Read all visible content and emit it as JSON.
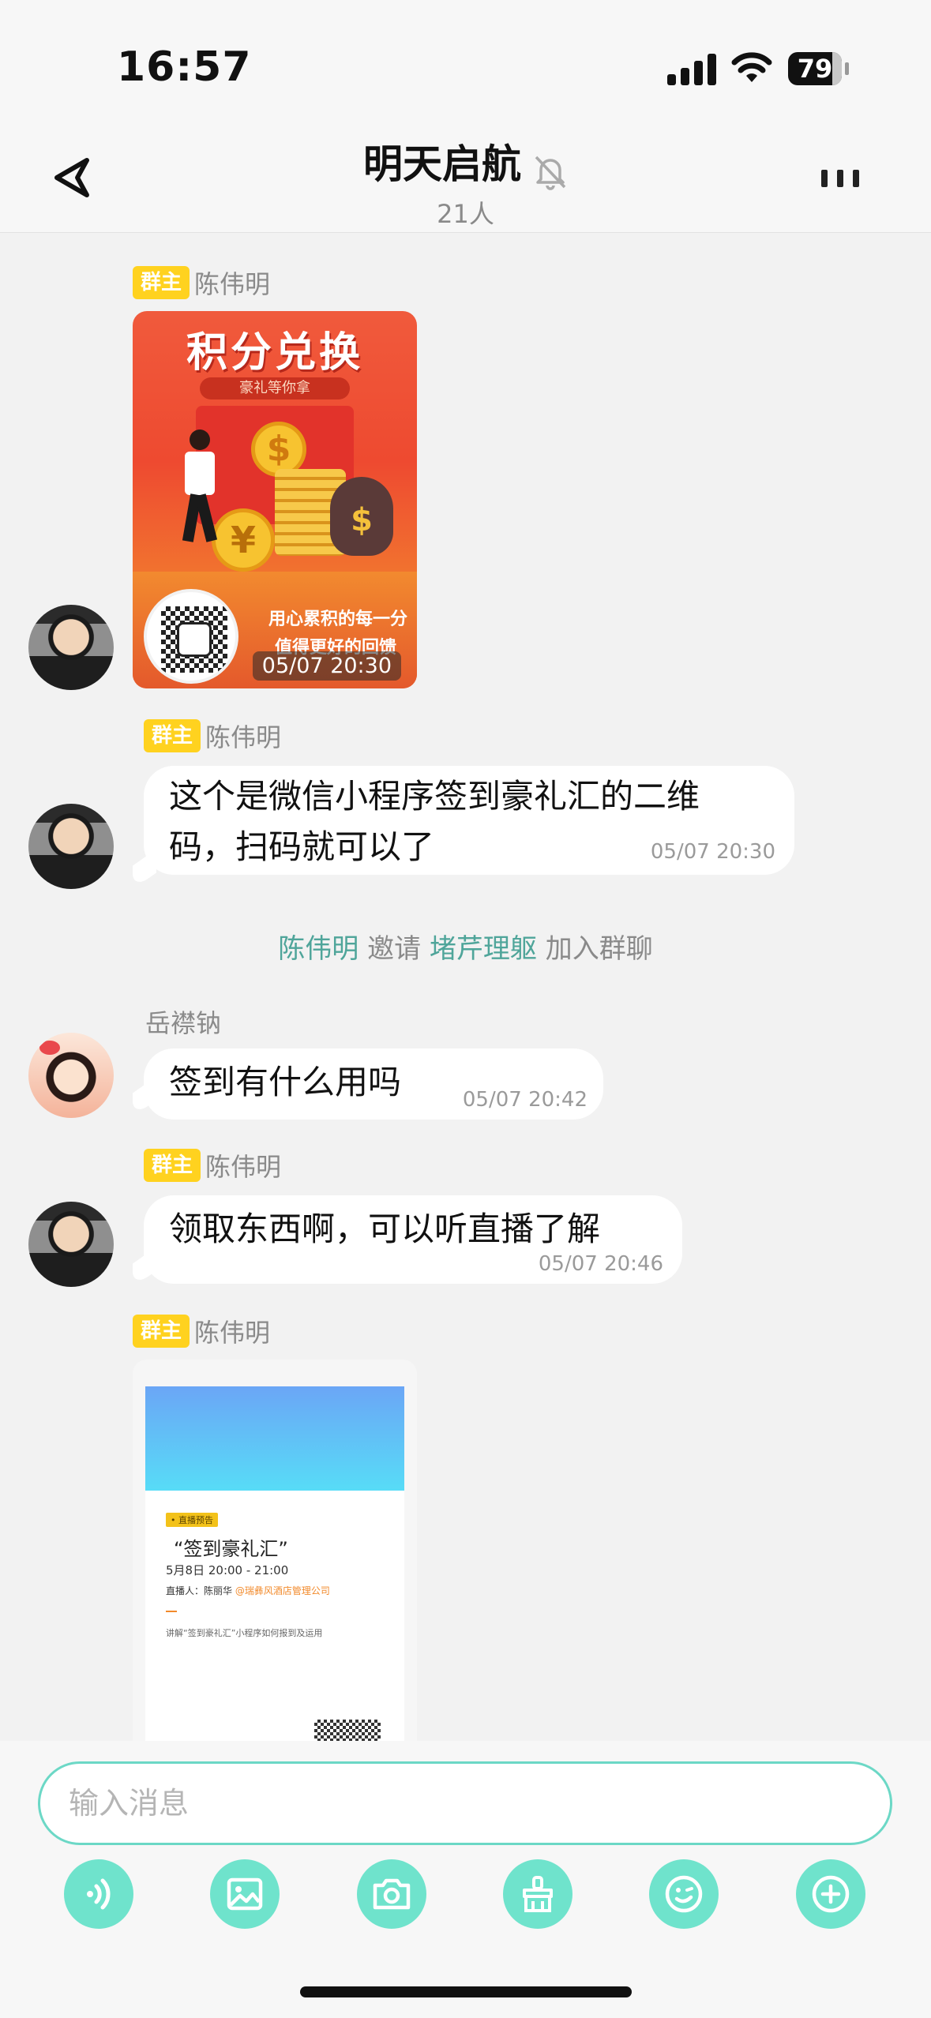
{
  "status_bar": {
    "time": "16:57",
    "battery": "79"
  },
  "header": {
    "title": "明天启航",
    "member_count": "21人"
  },
  "owner_tag": "群主",
  "messages": [
    {
      "sender": "陈伟明",
      "is_owner": true,
      "type": "image",
      "time": "05/07 20:30",
      "poster": {
        "title": "积分兑换",
        "ribbon": "豪礼等你拿",
        "slogan1": "用心累积的每一分",
        "slogan2": "值得更好的回馈"
      }
    },
    {
      "sender": "陈伟明",
      "is_owner": true,
      "type": "text",
      "text_line1": "这个是微信小程序签到豪礼汇的二维",
      "text_line2": "码，扫码就可以了",
      "time": "05/07 20:30"
    },
    {
      "type": "system",
      "inviter": "陈伟明",
      "invite_word": "邀请",
      "invitee": "堵芹理躯",
      "join_text": "加入群聊"
    },
    {
      "sender": "岳襟钠",
      "is_owner": false,
      "type": "text",
      "text": "签到有什么用吗",
      "time": "05/07 20:42"
    },
    {
      "sender": "陈伟明",
      "is_owner": true,
      "type": "text",
      "text": "领取东西啊，可以听直播了解",
      "time": "05/07 20:46"
    },
    {
      "sender": "陈伟明",
      "is_owner": true,
      "type": "image",
      "card": {
        "tag": "• 直播预告",
        "title": "“签到豪礼汇”",
        "date": "5月8日 20:00 - 21:00",
        "host_label": "直播人：",
        "host_name": "陈丽华",
        "host_org": "@瑞彝风酒店管理公司",
        "desc": "讲解“签到豪礼汇”小程序如何报到及运用"
      }
    }
  ],
  "input": {
    "placeholder": "输入消息"
  },
  "toolbar_icons": [
    "voice-icon",
    "image-icon",
    "camera-icon",
    "brush-icon",
    "emoji-icon",
    "plus-icon"
  ],
  "colors": {
    "accent": "#6fe3cc",
    "owner_tag": "#ffd21f",
    "system_highlight": "#4fa59a"
  }
}
